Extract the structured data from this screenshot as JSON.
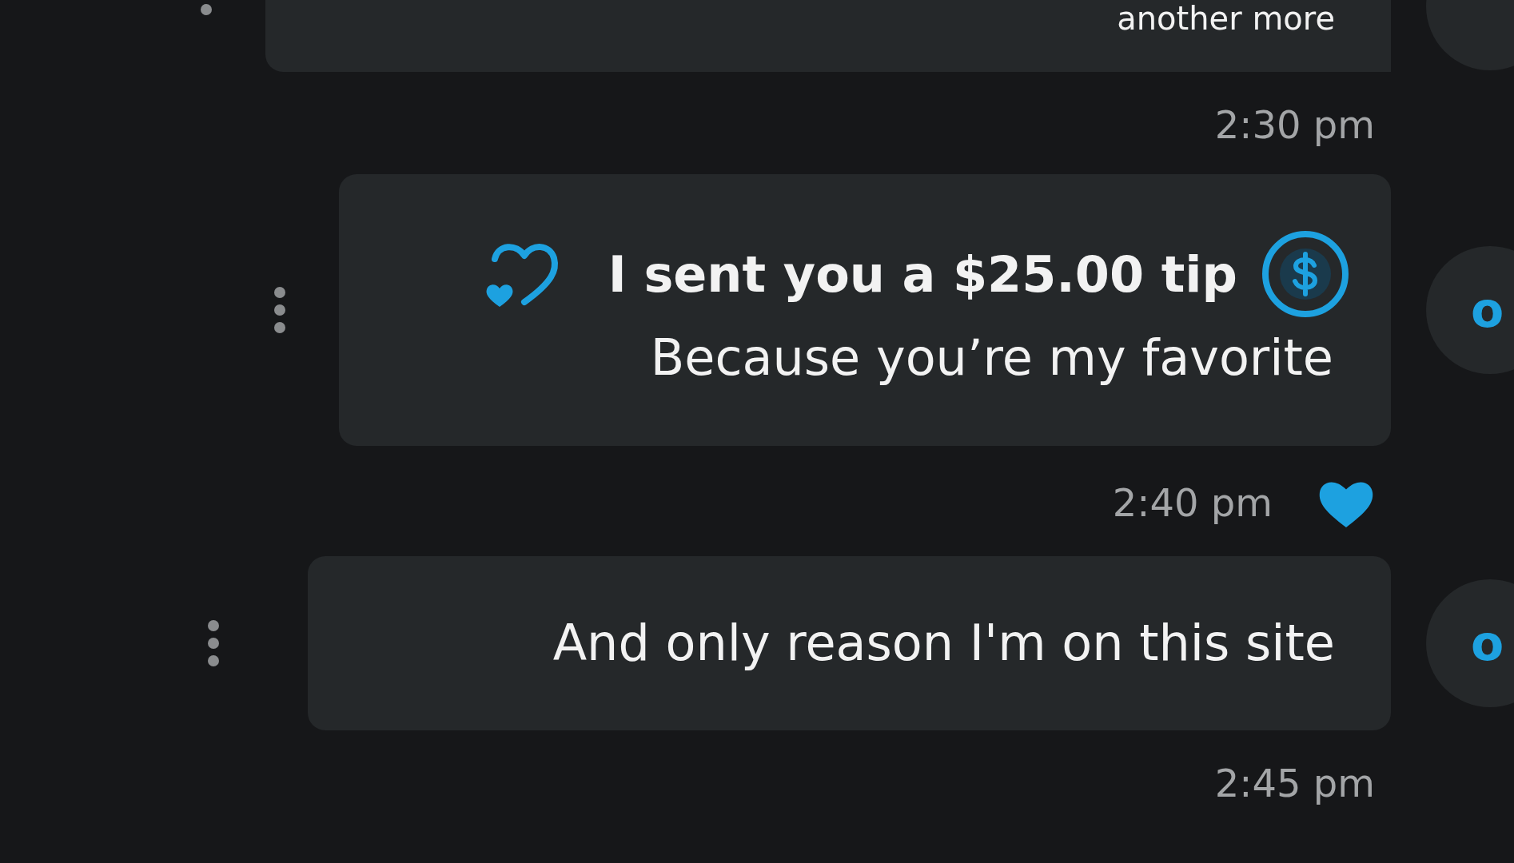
{
  "messages": [
    {
      "kind": "partial",
      "text": "another more",
      "time": "2:30 pm",
      "liked": false
    },
    {
      "kind": "tip",
      "title": "I sent you a $25.00 tip",
      "text": "Because you’re my favorite",
      "time": "2:40 pm",
      "liked": true,
      "avatar": "o"
    },
    {
      "kind": "text",
      "text": "And only reason I'm on this site",
      "time": "2:45 pm",
      "liked": false,
      "avatar": "o"
    }
  ]
}
